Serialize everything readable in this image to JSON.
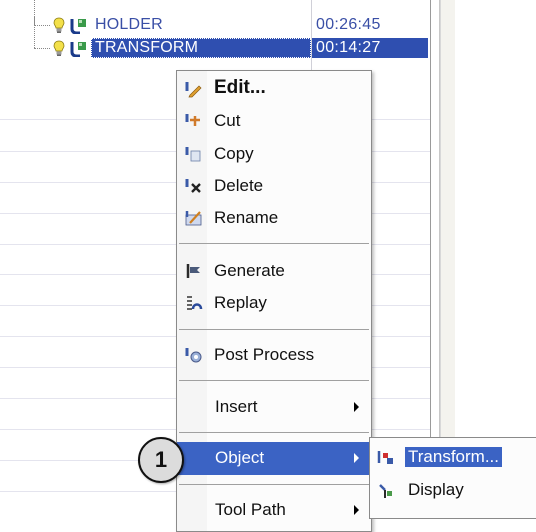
{
  "tree": {
    "rows": [
      {
        "name": "HOLDER",
        "time": "00:26:45",
        "selected": false
      },
      {
        "name": "TRANSFORM",
        "time": "00:14:27",
        "selected": true
      }
    ]
  },
  "context_menu": {
    "items": [
      {
        "label": "Edit...",
        "icon": "edit-icon",
        "bold": true
      },
      {
        "label": "Cut",
        "icon": "cut-icon"
      },
      {
        "label": "Copy",
        "icon": "copy-icon"
      },
      {
        "label": "Delete",
        "icon": "delete-icon"
      },
      {
        "label": "Rename",
        "icon": "rename-icon"
      },
      {
        "label": "Generate",
        "icon": "generate-icon"
      },
      {
        "label": "Replay",
        "icon": "replay-icon"
      },
      {
        "label": "Post Process",
        "icon": "post-process-icon"
      },
      {
        "label": "Insert",
        "has_submenu": true
      },
      {
        "label": "Object",
        "has_submenu": true,
        "highlighted": true
      },
      {
        "label": "Tool Path",
        "has_submenu": true
      }
    ]
  },
  "object_submenu": {
    "items": [
      {
        "label": "Transform...",
        "icon": "transform-icon",
        "highlighted": true
      },
      {
        "label": "Display",
        "icon": "display-icon"
      }
    ]
  },
  "callout": {
    "label": "1"
  },
  "colors": {
    "selection": "#2f4fb0",
    "menu_highlight": "#3b63c4",
    "tree_text": "#3a4fa6"
  }
}
